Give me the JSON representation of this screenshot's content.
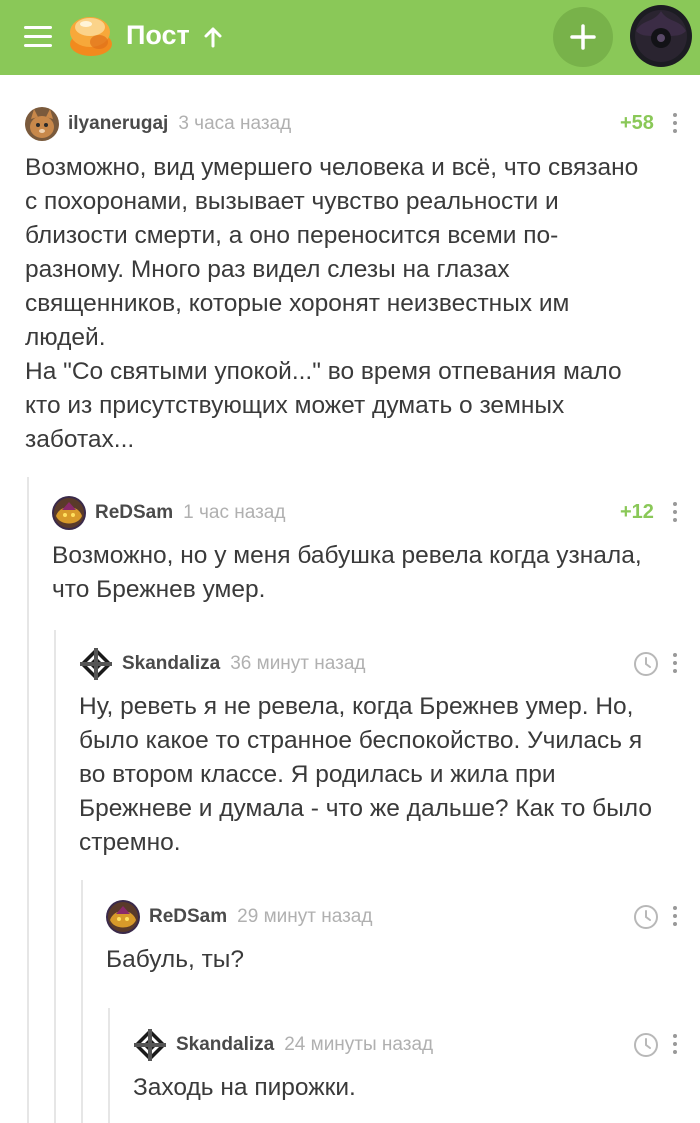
{
  "header": {
    "title": "Пост",
    "brand_color": "#8ac858"
  },
  "comments": [
    {
      "user": "ilyanerugaj",
      "time": "3 часа назад",
      "rating": "+58",
      "text": "Возможно, вид умершего человека и всё, что связано\nс похоронами, вызывает чувство реальности и\nблизости смерти, а оно переносится всеми по-\nразному. Много раз видел слезы на глазах\nсвященников, которые хоронят неизвестных им\nлюдей.\nНа \"Со святыми упокой...\" во время отпевания мало\nкто из присутствующих может думать о земных\nзаботах..."
    },
    {
      "user": "ReDSam",
      "time": "1 час назад",
      "rating": "+12",
      "text": "Возможно, но у меня бабушка ревела когда узнала,\nчто Брежнев умер."
    },
    {
      "user": "Skandaliza",
      "time": "36 минут назад",
      "text": "Ну, реветь я не ревела, когда Брежнев умер. Но,\nбыло какое то странное беспокойство. Училась я\nво втором классе. Я родилась и жила при\nБрежневе и думала - что же дальше? Как то было\nстремно."
    },
    {
      "user": "ReDSam",
      "time": "29 минут назад",
      "text": "Бабуль, ты?"
    },
    {
      "user": "Skandaliza",
      "time": "24 минуты назад",
      "text": "Заходь на пирожки."
    }
  ]
}
